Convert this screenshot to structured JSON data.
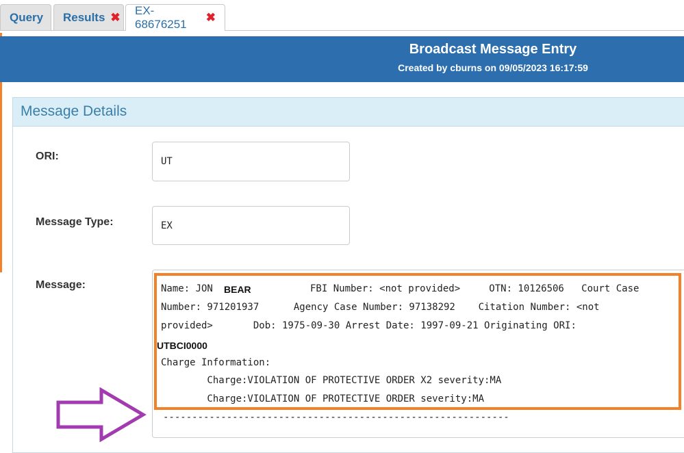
{
  "tabs": [
    {
      "label": "Query",
      "closable": false
    },
    {
      "label": "Results",
      "closable": true
    },
    {
      "label": "EX-68676251",
      "closable": true,
      "active": true
    }
  ],
  "close_glyph": "✖",
  "header": {
    "title": "Broadcast Message Entry",
    "subtitle": "Created by cburns on 09/05/2023 16:17:59"
  },
  "panel": {
    "title": "Message Details",
    "ori_label": "ORI:",
    "ori_value": "UT",
    "message_type_label": "Message Type:",
    "message_type_value": "EX",
    "message_label": "Message:"
  },
  "message": {
    "line1_prefix": "Name: JON ",
    "line1_name_bold": "BEAR",
    "line1_rest": "FBI Number: <not provided>     OTN: 10126506   Court Case",
    "line2": "Number: 971201937      Agency Case Number: 97138292    Citation Number: <not",
    "line3": "provided>       Dob: 1975-09-30 Arrest Date: 1997-09-21 Originating ORI:",
    "line4_bold": "UTBCI0000",
    "line5": "Charge Information:",
    "line6": "        Charge:VIOLATION OF PROTECTIVE ORDER X2 severity:MA",
    "line7": "        Charge:VIOLATION OF PROTECTIVE ORDER severity:MA",
    "line8": "------------------------------------------------------------"
  },
  "colors": {
    "header_bg": "#2d6fae",
    "highlight": "#f2822a",
    "arrow": "#a23bb0",
    "close": "#e0202a"
  }
}
